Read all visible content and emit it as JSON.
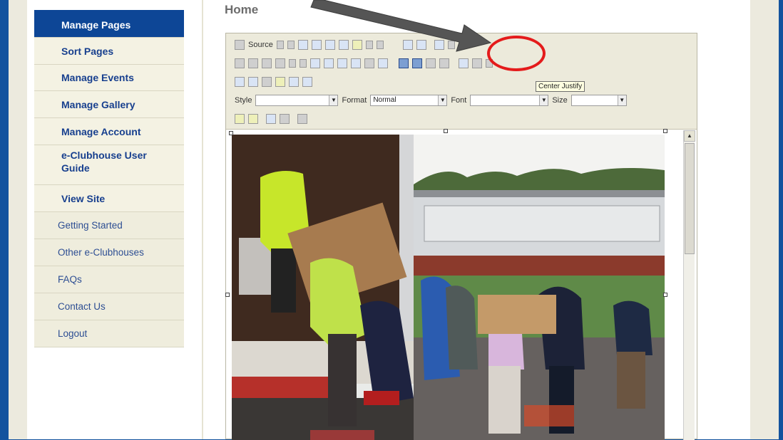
{
  "nav": {
    "primary": [
      {
        "label": "Manage Pages",
        "active": true
      },
      {
        "label": "Sort Pages"
      },
      {
        "label": "Manage Events"
      },
      {
        "label": "Manage Gallery"
      },
      {
        "label": "Manage Account"
      },
      {
        "label": "e-Clubhouse User Guide"
      },
      {
        "label": "View Site"
      }
    ],
    "secondary": [
      {
        "label": "Getting Started"
      },
      {
        "label": "Other e-Clubhouses"
      },
      {
        "label": "FAQs"
      },
      {
        "label": "Contact Us"
      },
      {
        "label": "Logout"
      }
    ]
  },
  "content": {
    "title": "Home"
  },
  "editor": {
    "source_label": "Source",
    "style_label": "Style",
    "style_value": "",
    "format_label": "Format",
    "format_value": "Normal",
    "font_label": "Font",
    "font_value": "",
    "size_label": "Size",
    "size_value": "",
    "tooltip": "Center Justify"
  },
  "colors": {
    "frame_blue": "#13539e",
    "nav_active_bg": "#0d4696",
    "highlight_red": "#e41b1b",
    "arrow_gray": "#555555"
  }
}
